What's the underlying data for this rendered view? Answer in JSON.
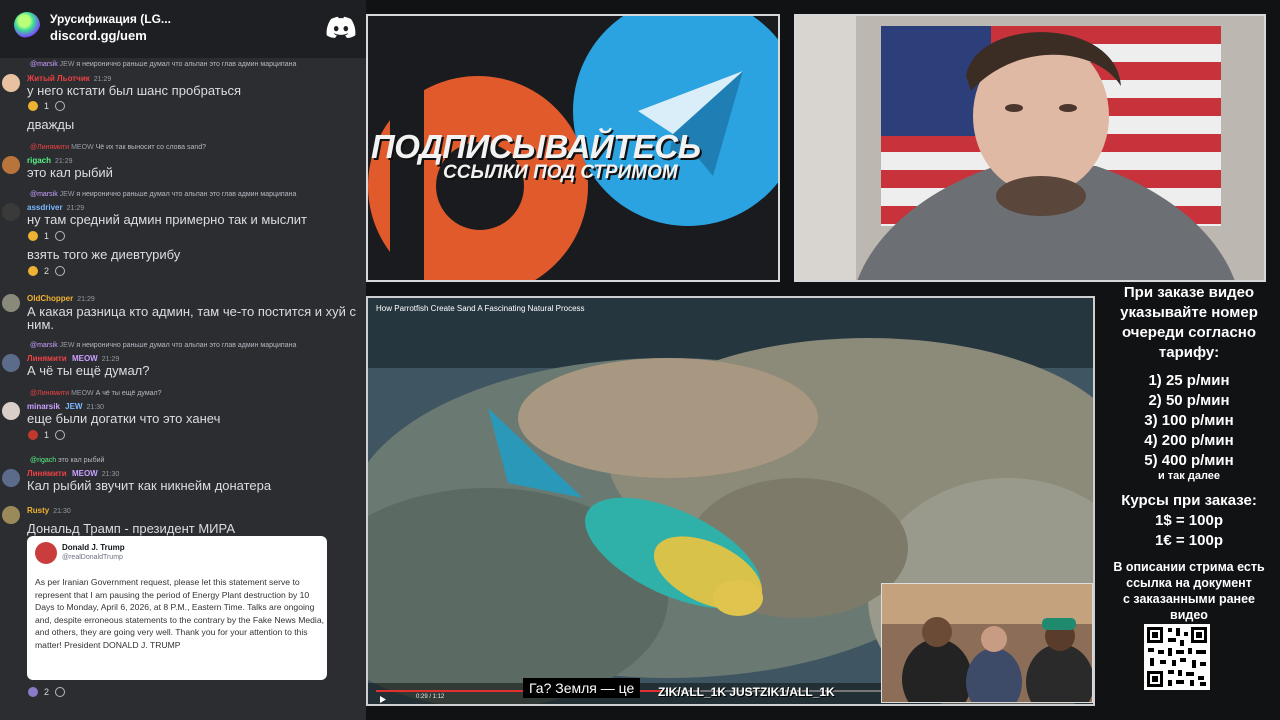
{
  "server": {
    "name": "Урусификация (LG...",
    "invite": "discord.gg/uem"
  },
  "messages": [
    {
      "reply_user": "@marsik",
      "reply_badge": "JEW",
      "reply_text": "я неиронично раньше думал что альпан это глав админ марципана"
    },
    {
      "author": "Житый Льотчик",
      "time": "21:29",
      "text": "у него кстати был шанс пробраться",
      "reaction_count": "1"
    },
    {
      "text": "дважды"
    },
    {
      "reply_user": "@Линямити",
      "reply_badge": "MEOW",
      "reply_text": "Чё их так выносит со слова sand?"
    },
    {
      "author": "rigach",
      "time": "21:29",
      "text": "это кал рыбий"
    },
    {
      "reply_user": "@marsik",
      "reply_badge": "JEW",
      "reply_text": "я неиронично раньше думал что альпан это глав админ марципана"
    },
    {
      "author": "assdriver",
      "time": "21:29",
      "text": "ну там средний админ примерно так и мыслит",
      "reaction_count": "1"
    },
    {
      "text": "взять того же диевтурибу",
      "reaction_count": "2"
    },
    {
      "author": "OldChopper",
      "time": "21:29",
      "text": "А какая разница кто админ, там че-то постится и хуй с",
      "text2": "ним."
    },
    {
      "reply_user": "@marsik",
      "reply_badge": "JEW",
      "reply_text": "я неиронично раньше думал что альпан это глав админ марципана"
    },
    {
      "author": "Линямити",
      "badge": "MEOW",
      "time": "21:29",
      "text": "А чё ты ещё думал?"
    },
    {
      "reply_user": "@Линямити",
      "reply_badge": "MEOW",
      "reply_text": "А чё ты ещё думал?"
    },
    {
      "author": "minarsik",
      "badge": "JEW",
      "time": "21:30",
      "text": "еще были догатки что это ханеч",
      "reaction_count": "1"
    },
    {
      "reply_user": "@rigach",
      "reply_text": "это кал рыбий"
    },
    {
      "author": "Линямити",
      "badge": "MEOW",
      "time": "21:30",
      "text": "Кал рыбий звучит как никнейм донатера"
    },
    {
      "author": "Rusty",
      "time": "21:30",
      "text": "Дональд Трамп - президент МИРА",
      "reaction_count": "2"
    }
  ],
  "trump_post": {
    "name": "Donald J. Trump",
    "handle": "@realDonaldTrump",
    "body": "As per Iranian Government request, please let this statement serve to represent that I am pausing the period of Energy Plant destruction by 10 Days to Monday, April 6, 2026, at 8 P.M., Eastern Time. Talks are ongoing and, despite erroneous statements to the contrary by the Fake News Media, and others, they are going very well. Thank you for your attention to this matter! President DONALD J. TRUMP"
  },
  "banner": {
    "title": "ПОДПИСЫВАЙТЕСЬ",
    "subtitle": "ССЫЛКИ ПОД СТРИМОМ"
  },
  "video": {
    "title": "How Parrotfish Create Sand A Fascinating Natural Process",
    "subtitle": "Га?  Земля — це",
    "overlay_handles": "ZIK/ALL_1K  JUSTZIK1/ALL_1K",
    "time": "0:29 / 1:12",
    "progress": 0.4
  },
  "info": {
    "order_lines": [
      "При заказе видео",
      "указывайте номер",
      "очереди согласно",
      "тарифу:"
    ],
    "tariffs": [
      "1) 25 р/мин",
      "2) 50 р/мин",
      "3) 100 р/мин",
      "4) 200 р/мин",
      "5) 400 р/мин"
    ],
    "tariff_more": "и так далее",
    "courses_title": "Курсы при заказе:",
    "courses": [
      "1$ = 100р",
      "1€ = 100р"
    ],
    "description_lines": [
      "В описании стрима есть",
      "ссылка на документ",
      "с заказанными ранее",
      "видео"
    ]
  },
  "colors": {
    "chat_bg": "#2b2d31",
    "header_bg": "#1e1f22",
    "name_gold": "#f0b232",
    "name_green": "#57f287",
    "name_purple": "#c9a0ff",
    "name_red": "#ed4245",
    "name_blue": "#7ab8ff",
    "banner_orange": "#e05a2b",
    "telegram_blue": "#2aa3e0"
  }
}
